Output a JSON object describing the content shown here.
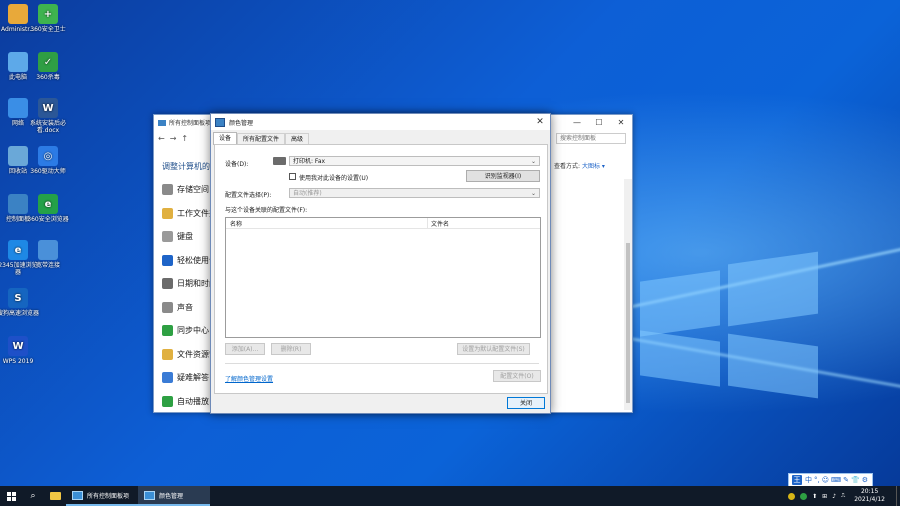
{
  "desktop_icons": [
    {
      "label": "Administr...",
      "color": "#e8a93a",
      "glyph": ""
    },
    {
      "label": "360安全卫士",
      "color": "#3eb34f",
      "glyph": "+"
    },
    {
      "label": "此电脑",
      "color": "#5da9e9",
      "glyph": ""
    },
    {
      "label": "360杀毒",
      "color": "#2f9e44",
      "glyph": "✓"
    },
    {
      "label": "网络",
      "color": "#3a8ee6",
      "glyph": ""
    },
    {
      "label": "系统安装后必看.docx",
      "color": "#2b5797",
      "glyph": "W"
    },
    {
      "label": "回收站",
      "color": "#6aa8d8",
      "glyph": ""
    },
    {
      "label": "360驱动大师",
      "color": "#2c7be5",
      "glyph": "◎"
    },
    {
      "label": "控制面板",
      "color": "#3b82c4",
      "glyph": ""
    },
    {
      "label": "360安全浏览器",
      "color": "#24a148",
      "glyph": "e"
    },
    {
      "label": "2345加速浏览器",
      "color": "#1e88e5",
      "glyph": "e"
    },
    {
      "label": "宽带连接",
      "color": "#4a90d9",
      "glyph": ""
    },
    {
      "label": "搜狗高速浏览器",
      "color": "#1565c0",
      "glyph": "S"
    },
    {
      "label": "WPS 2019",
      "color": "#1e50c8",
      "glyph": "W"
    }
  ],
  "control_panel": {
    "title": "所有控制面板项",
    "address": "搜索控制面板",
    "heading": "调整计算机的设",
    "view_label": "查看方式:",
    "view_value": "大图标 ▾",
    "items": [
      {
        "label": "存储空间",
        "color": "#8a8a8a"
      },
      {
        "label": "工作文件夹",
        "color": "#e0b040"
      },
      {
        "label": "键盘",
        "color": "#9a9a9a"
      },
      {
        "label": "轻松使用设置中心",
        "color": "#1e64c8"
      },
      {
        "label": "日期和时间",
        "color": "#6b6b6b"
      },
      {
        "label": "声音",
        "color": "#8a8a8a"
      },
      {
        "label": "同步中心",
        "color": "#2ea043"
      },
      {
        "label": "文件资源管理器选项",
        "color": "#e0b040"
      },
      {
        "label": "疑难解答",
        "color": "#3a7bd5"
      },
      {
        "label": "自动播放",
        "color": "#2ea043"
      }
    ]
  },
  "dialog": {
    "title": "颜色管理",
    "close": "✕",
    "tabs": [
      "设备",
      "所有配置文件",
      "高级"
    ],
    "device_label": "设备(D):",
    "device_value": "打印机: Fax",
    "use_settings_label": "使用我对此设备的设置(U)",
    "identify_button": "识别监视器(I)",
    "profile_select_label": "配置文件选择(P):",
    "profile_select_value": "自动(推荐)",
    "associated_label": "与这个设备关联的配置文件(F):",
    "list_columns": [
      "名称",
      "文件名"
    ],
    "add_button": "添加(A)...",
    "remove_button": "删除(R)",
    "set_default_button": "设置为默认配置文件(S)",
    "learn_link": "了解颜色管理设置",
    "profiles_button": "配置文件(O)",
    "close_button": "关闭"
  },
  "taskbar": {
    "tasks": [
      "所有控制面板项",
      "颜色管理"
    ],
    "time": "20:15",
    "date": "2021/4/12",
    "tray_glyphs": [
      "⬆",
      "⊞",
      "♪",
      "⎍"
    ]
  },
  "ime": {
    "logo": "王",
    "items": [
      "中",
      "°,",
      "☺",
      "⌨",
      "✎",
      "👕",
      "⚙"
    ]
  },
  "window_controls": {
    "minimize": "—",
    "maximize": "☐",
    "close": "✕"
  },
  "nav_arrows": {
    "back": "←",
    "forward": "→",
    "up": "↑"
  }
}
